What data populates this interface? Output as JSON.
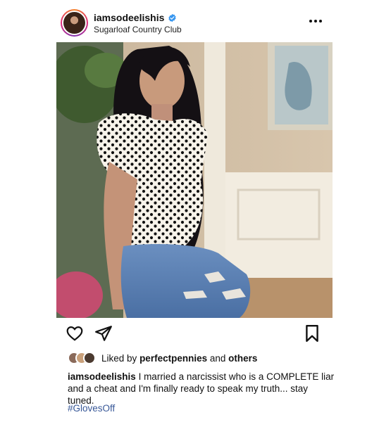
{
  "post": {
    "username": "iamsodeelishis",
    "location": "Sugarloaf Country Club",
    "verified": true,
    "photo_alt": "Woman in polka dot blouse and ripped jeans",
    "likes": {
      "prefix": "Liked by",
      "user": "perfectpennies",
      "conjunction": "and",
      "others": "others"
    },
    "caption": {
      "username": "iamsodeelishis",
      "text": "I married a narcissist who is a COMPLETE liar and a cheat and I'm finally ready to speak my truth... stay tuned."
    },
    "hashtag": "#GlovesOff"
  },
  "colors": {
    "verified": "#3897f0",
    "hashtag": "#385898",
    "text": "#111111"
  },
  "icons": [
    "more-options-icon",
    "heart-icon",
    "share-icon",
    "bookmark-icon",
    "verified-badge-icon"
  ]
}
